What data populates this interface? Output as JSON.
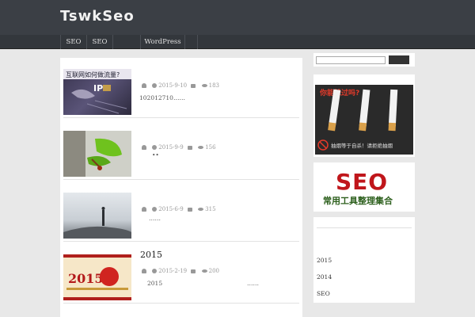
{
  "site": {
    "logo": "TswkSeo"
  },
  "nav": {
    "items": [
      "SEO",
      "SEO",
      "",
      "WordPress",
      ""
    ]
  },
  "posts": [
    {
      "title": "",
      "date": "2015-9-10",
      "views": "183",
      "excerpt": "102012710……"
    },
    {
      "title": "",
      "date": "2015-9-9",
      "views": "156",
      "excerpt": "••"
    },
    {
      "title": "",
      "date": "2015-6-9",
      "views": "315",
      "excerpt": "……"
    },
    {
      "title": "2015",
      "date": "2015-2-19",
      "views": "200",
      "excerpt": "2015",
      "excerpt_tail": "……"
    }
  ],
  "thumb_texts": {
    "post1_caption": "互联网如何做流量?",
    "post1_ip": "IP",
    "post4_year": "2015"
  },
  "search": {
    "placeholder": "",
    "button": ""
  },
  "sidebar": {
    "ad_top_text": "你能躲过吗?",
    "ad_bottom_text": "抽烟等于自杀！请拒绝抽烟",
    "seo_big": "SEO",
    "seo_sub": "常用工具整理集合",
    "archive": [
      "2015",
      "2014",
      "SEO"
    ]
  },
  "colors": {
    "header": "#3b3f45",
    "nav": "#33373c",
    "seo_red": "#c0161b",
    "seo_green": "#2c5f1c"
  }
}
